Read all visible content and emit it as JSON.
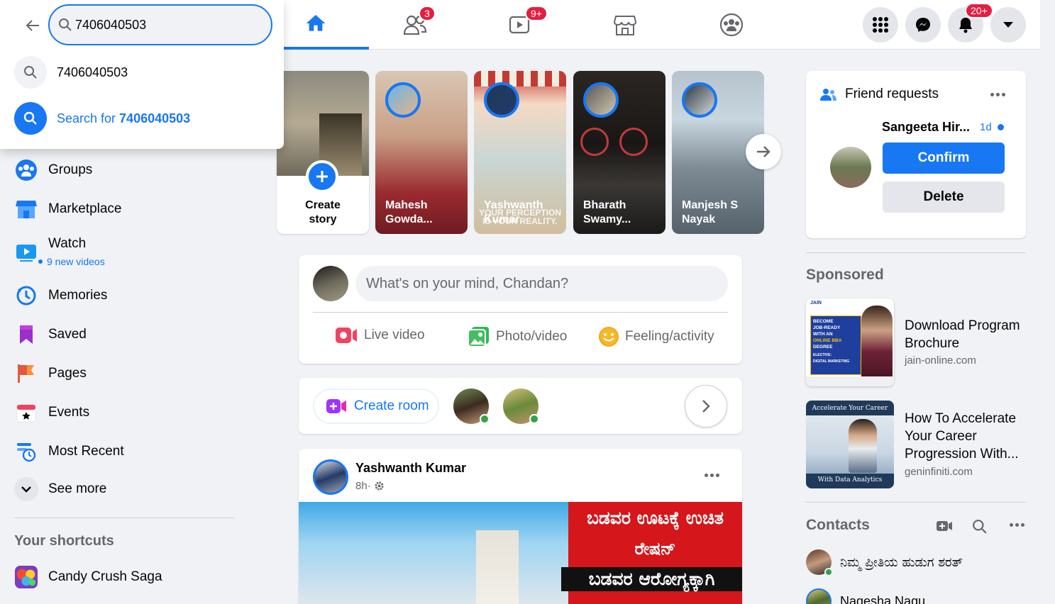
{
  "search": {
    "value": "7406040503",
    "suggestion": "7406040503",
    "search_for_prefix": "Search for ",
    "search_for_query": "7406040503"
  },
  "nav": {
    "friends_badge": "3",
    "watch_badge": "9+",
    "notifications_badge": "20+"
  },
  "sidebar": {
    "items": [
      {
        "label": "Groups"
      },
      {
        "label": "Marketplace"
      },
      {
        "label": "Watch",
        "sub": "9 new videos"
      },
      {
        "label": "Memories"
      },
      {
        "label": "Saved"
      },
      {
        "label": "Pages"
      },
      {
        "label": "Events"
      },
      {
        "label": "Most Recent"
      },
      {
        "label": "See more"
      }
    ],
    "shortcuts_title": "Your shortcuts",
    "shortcuts": [
      {
        "label": "Candy Crush Saga"
      }
    ]
  },
  "stories": {
    "create_label": "Create story",
    "items": [
      {
        "name": "Mahesh Gowda..."
      },
      {
        "name": "Yashwanth Kumar",
        "overlay": "YOUR PERCEPTION IS YOUR REALITY."
      },
      {
        "name": "Bharath Swamy..."
      },
      {
        "name": "Manjesh S Nayak"
      }
    ]
  },
  "composer": {
    "placeholder": "What's on your mind, Chandan?",
    "live": "Live video",
    "photo": "Photo/video",
    "feeling": "Feeling/activity"
  },
  "rooms": {
    "create_label": "Create room"
  },
  "post": {
    "author": "Yashwanth Kumar",
    "time": "8h",
    "time_sep": " · ",
    "banner_line1": "ಬಡವರ ಊಟಕ್ಕೆ ಉಚಿತ",
    "banner_line2": "ರೇಷನ್",
    "banner_line3": "ಬಡವರ ಆರೋಗ್ಯಕ್ಕಾಗಿ"
  },
  "friend_requests": {
    "title": "Friend requests",
    "name": "Sangeeta Hir...",
    "age": "1d",
    "confirm": "Confirm",
    "delete": "Delete"
  },
  "sponsored": {
    "title": "Sponsored",
    "ads": [
      {
        "title": "Download Program Brochure",
        "domain": "jain-online.com",
        "img_brand": "JAIN",
        "img_l1": "BECOME",
        "img_l2": "JOB-READY",
        "img_l3": "WITH AN",
        "img_l4": "ONLINE BBA",
        "img_l5": "DEGREE",
        "img_l6": "ELECTIVE:",
        "img_l7": "DIGITAL MARKETING"
      },
      {
        "title": "How To Accelerate Your Career Progression With...",
        "domain": "geninfiniti.com",
        "img_top": "Accelerate Your Career",
        "img_bottom": "With Data Analytics"
      }
    ]
  },
  "contacts": {
    "title": "Contacts",
    "items": [
      {
        "name": "ನಿಮ್ಮ ಪ್ರೀತಿಯ ಹುಡುಗ ಶರತ್"
      },
      {
        "name": "Nagesha Nagu"
      }
    ]
  },
  "colors": {
    "accent": "#1877f2",
    "badge": "#e41e3f",
    "online": "#31a24c"
  }
}
